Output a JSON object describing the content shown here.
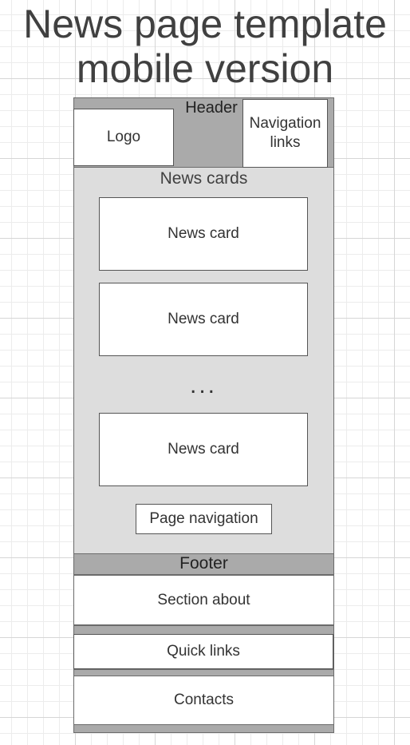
{
  "title": "News page template\nmobile version",
  "header": {
    "label": "Header",
    "logo": "Logo",
    "navigation": "Navigation\nlinks"
  },
  "news_cards": {
    "label": "News cards",
    "cards": [
      "News card",
      "News card",
      "News card"
    ],
    "ellipsis": "...",
    "page_navigation": "Page navigation"
  },
  "footer": {
    "label": "Footer",
    "sections": [
      "Section about",
      "Quick links",
      "Contacts"
    ]
  },
  "colors": {
    "container_fill": "#dddddd",
    "section_fill": "#aaaaaa",
    "box_fill": "#ffffff",
    "outline": "#6b6b6b"
  }
}
